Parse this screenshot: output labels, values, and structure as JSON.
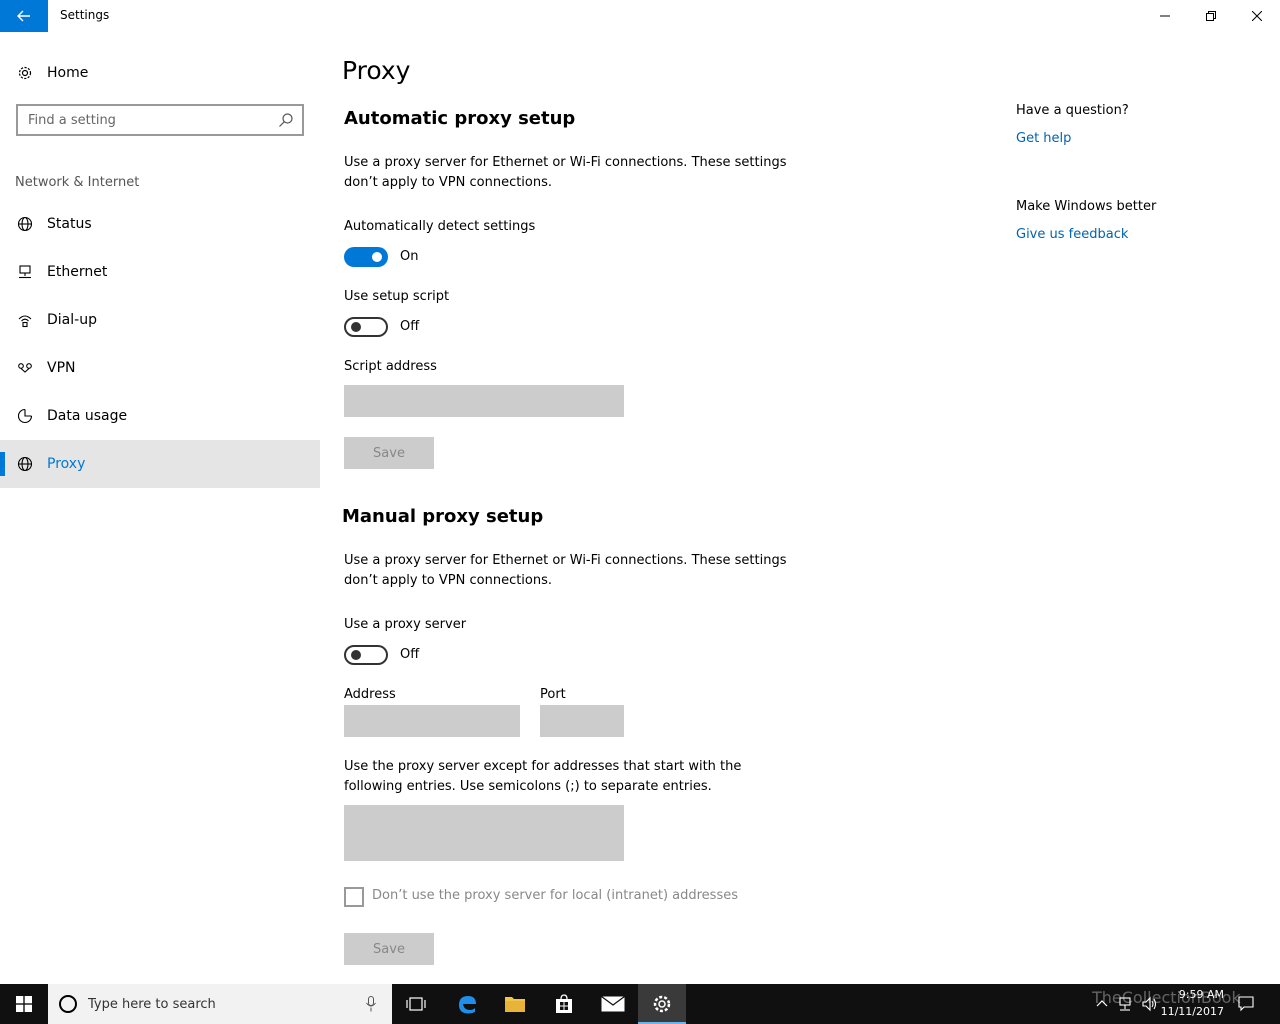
{
  "window": {
    "title": "Settings"
  },
  "sidebar": {
    "home_label": "Home",
    "search_placeholder": "Find a setting",
    "section_label": "Network & Internet",
    "items": [
      {
        "label": "Status",
        "icon": "globe-status-icon"
      },
      {
        "label": "Ethernet",
        "icon": "ethernet-icon"
      },
      {
        "label": "Dial-up",
        "icon": "dialup-icon"
      },
      {
        "label": "VPN",
        "icon": "vpn-icon"
      },
      {
        "label": "Data usage",
        "icon": "data-usage-icon"
      },
      {
        "label": "Proxy",
        "icon": "globe-icon",
        "active": true
      }
    ]
  },
  "main": {
    "page_title": "Proxy",
    "automatic": {
      "heading": "Automatic proxy setup",
      "description": "Use a proxy server for Ethernet or Wi-Fi connections. These settings don’t apply to VPN connections.",
      "auto_detect_label": "Automatically detect settings",
      "auto_detect_state": "On",
      "setup_script_label": "Use setup script",
      "setup_script_state": "Off",
      "script_address_label": "Script address",
      "script_address_value": "",
      "save_label": "Save"
    },
    "manual": {
      "heading": "Manual proxy setup",
      "description": "Use a proxy server for Ethernet or Wi-Fi connections. These settings don’t apply to VPN connections.",
      "use_proxy_label": "Use a proxy server",
      "use_proxy_state": "Off",
      "address_label": "Address",
      "address_value": "",
      "port_label": "Port",
      "port_value": "",
      "exceptions_description": "Use the proxy server except for addresses that start with the following entries. Use semicolons (;) to separate entries.",
      "exceptions_value": "",
      "local_checkbox_label": "Don’t use the proxy server for local (intranet) addresses",
      "save_label": "Save"
    }
  },
  "aside": {
    "question_heading": "Have a question?",
    "get_help_link": "Get help",
    "better_heading": "Make Windows better",
    "feedback_link": "Give us feedback"
  },
  "taskbar": {
    "search_placeholder": "Type here to search",
    "time": "9:59 AM",
    "date": "11/11/2017",
    "watermark": "TheCollectionBook"
  },
  "colors": {
    "accent": "#0078d7",
    "link": "#0063b1",
    "active_nav_bg": "#e5e5e5",
    "disabled_field": "#cccccc",
    "taskbar": "#101010"
  }
}
